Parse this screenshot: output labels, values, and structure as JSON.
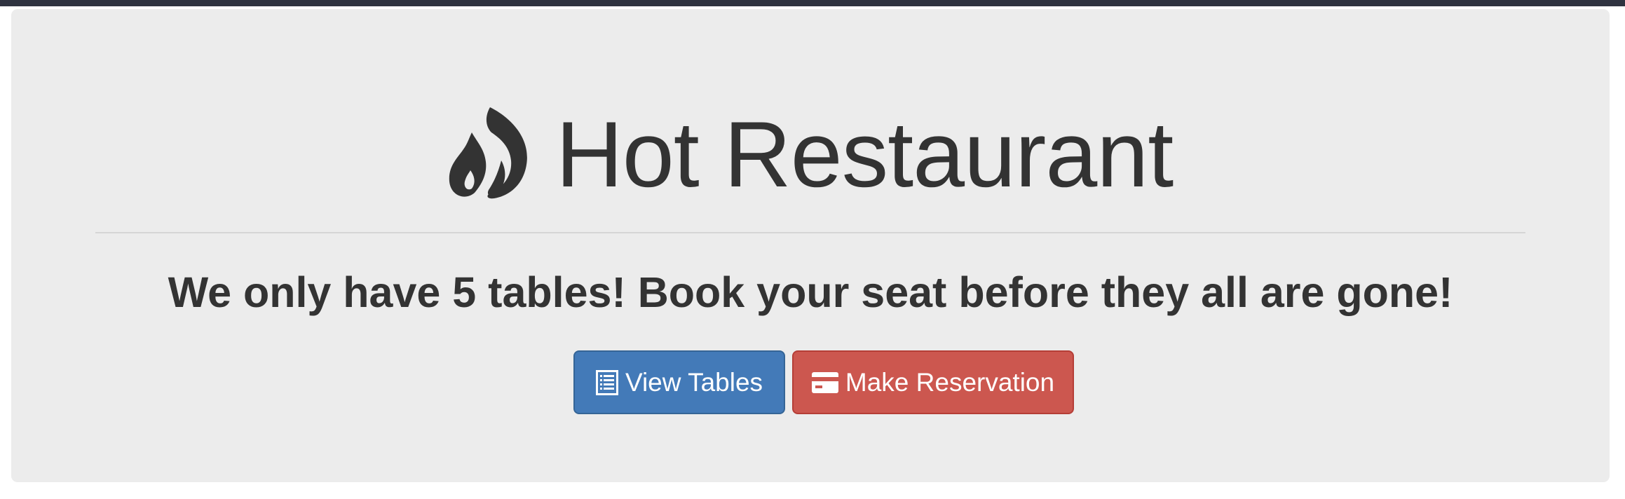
{
  "header": {
    "title": "Hot Restaurant",
    "icon": "fire-icon",
    "tagline": "We only have 5 tables! Book your seat before they all are gone!"
  },
  "actions": {
    "view_tables": {
      "label": "View Tables",
      "icon": "list-alt-icon",
      "color": "#437ab8"
    },
    "make_reservation": {
      "label": "Make Reservation",
      "icon": "credit-card-icon",
      "color": "#cc574f"
    }
  },
  "colors": {
    "top_bar": "#2f3340",
    "panel_background": "#ececec",
    "text": "#333333"
  }
}
